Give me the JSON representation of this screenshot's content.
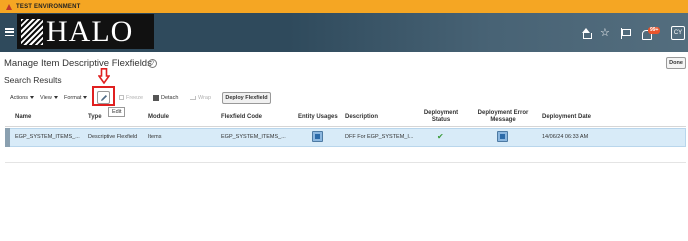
{
  "env_banner": {
    "text": "TEST ENVIRONMENT"
  },
  "header": {
    "logo_text": "HALO",
    "notification_count": "99+",
    "user_initials": "CY"
  },
  "page": {
    "title": "Manage Item Descriptive Flexfields",
    "done_label": "Done",
    "section_title": "Search Results"
  },
  "toolbar": {
    "actions_label": "Actions",
    "view_label": "View",
    "format_label": "Format",
    "freeze_label": "Freeze",
    "detach_label": "Detach",
    "wrap_label": "Wrap",
    "deploy_label": "Deploy Flexfield",
    "edit_tooltip": "Edit"
  },
  "table": {
    "headers": {
      "name": "Name",
      "type": "Type",
      "module": "Module",
      "flexfield_code": "Flexfield Code",
      "entity_usages": "Entity Usages",
      "description": "Description",
      "deployment_status_1": "Deployment",
      "deployment_status_2": "Status",
      "deployment_error_1": "Deployment Error",
      "deployment_error_2": "Message",
      "deployment_date": "Deployment Date"
    },
    "rows": [
      {
        "name": "EGP_SYSTEM_ITEMS_...",
        "type": "Descriptive Flexfield",
        "module": "Items",
        "flexfield_code": "EGP_SYSTEM_ITEMS_...",
        "description": "DFF For EGP_SYSTEM_I...",
        "deployment_date": "14/06/24 06:33 AM"
      }
    ]
  },
  "colors": {
    "env_banner": "#f5a623",
    "topbar": "#2f4a5c",
    "selected_row": "#d8ebf8",
    "annotation": "#e02020",
    "status_ok": "#3a9a3a"
  }
}
